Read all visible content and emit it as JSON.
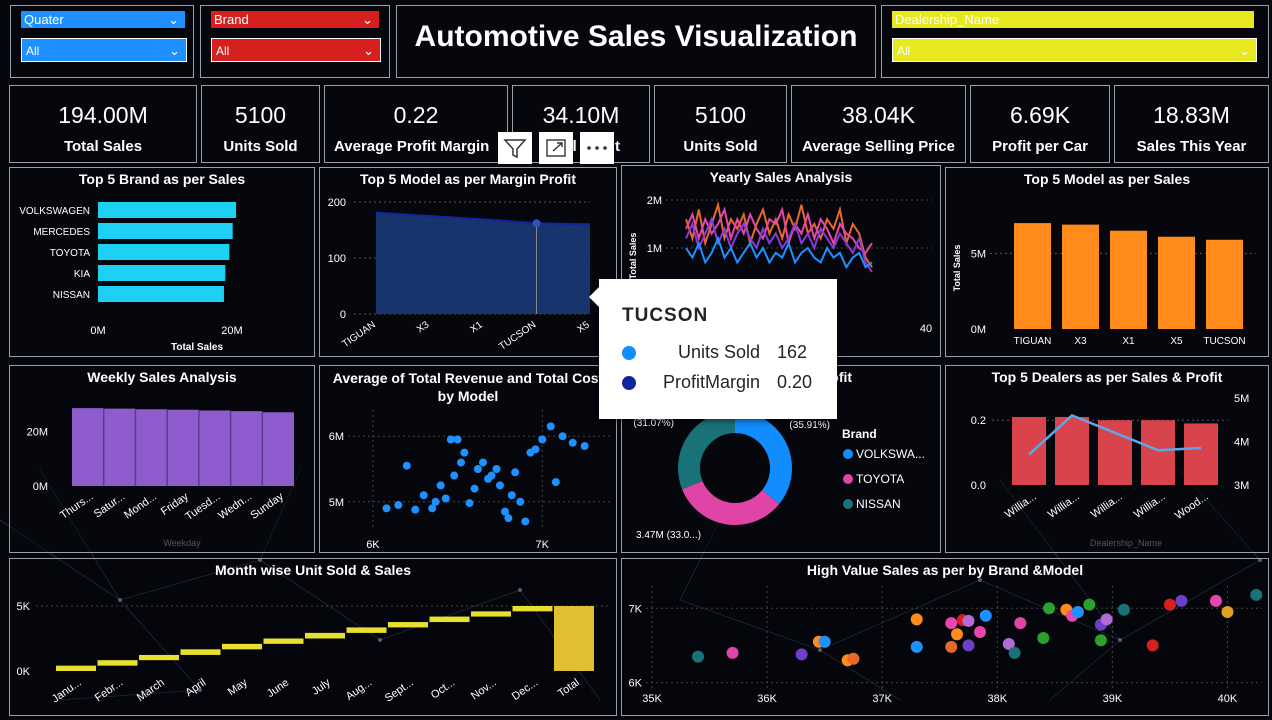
{
  "title": "Automotive Sales Visualization",
  "slicers": [
    {
      "label": "Quater",
      "value": "All",
      "color": "#1e90ff"
    },
    {
      "label": "Brand",
      "value": "All",
      "color": "#d62020"
    },
    {
      "label": "Dealership_Name",
      "value": "All",
      "color": "#e8e81e"
    }
  ],
  "kpis": [
    {
      "value": "194.00M",
      "label": "Total Sales"
    },
    {
      "value": "5100",
      "label": "Units Sold"
    },
    {
      "value": "0.22",
      "label": "Average Profit Margin"
    },
    {
      "value": "34.10M",
      "label": "Total Profit"
    },
    {
      "value": "5100",
      "label": "Units Sold"
    },
    {
      "value": "38.04K",
      "label": "Average Selling Price"
    },
    {
      "value": "6.69K",
      "label": "Profit per Car"
    },
    {
      "value": "18.83M",
      "label": "Sales This Year"
    }
  ],
  "visual_header_icons": [
    "filter-icon",
    "focus-mode-icon",
    "more-options-icon"
  ],
  "tooltip": {
    "title": "TUCSON",
    "rows": [
      {
        "name": "Units Sold",
        "value": "162",
        "color": "#118dff"
      },
      {
        "name": "ProfitMargin",
        "value": "0.20",
        "color": "#12239e"
      }
    ]
  },
  "chart_data": [
    {
      "id": "top5brand",
      "type": "bar",
      "orientation": "horizontal",
      "title": "Top 5 Brand as per Sales",
      "categories": [
        "VOLKSWAGEN",
        "MERCEDES",
        "TOYOTA",
        "KIA",
        "NISSAN"
      ],
      "values": [
        20.6,
        20.1,
        19.6,
        19.0,
        18.8
      ],
      "xlabel": "Total Sales",
      "xticks": [
        "0M",
        "20M"
      ],
      "xlim": [
        0,
        20
      ],
      "color": "#1fd0f5"
    },
    {
      "id": "top5margin",
      "type": "area",
      "title": "Top 5 Model as per Margin Profit",
      "categories": [
        "TIGUAN",
        "X3",
        "X1",
        "TUCSON",
        "X5"
      ],
      "values": [
        181,
        175,
        169,
        162,
        160
      ],
      "yticks": [
        "200",
        "100",
        "0"
      ],
      "ylim": [
        0,
        200
      ],
      "color": "#12239e"
    },
    {
      "id": "yearly",
      "type": "line",
      "title": "Yearly Sales Analysis",
      "ylabel": "Total Sales",
      "yticks": [
        "2M",
        "1M"
      ],
      "xticks": [
        "40"
      ],
      "series": [
        {
          "color": "#e8682c",
          "values": [
            1.6,
            1.2,
            1.8,
            1.1,
            1.5,
            1.9,
            1.2,
            1.6,
            1.4,
            1.7,
            1.1,
            1.5,
            1.8,
            1.3,
            1.6,
            1.2,
            1.7,
            1.4,
            1.9,
            1.3,
            1.5,
            1.2,
            1.6,
            1.4,
            1.8,
            1.1,
            1.5,
            1.3,
            0.8,
            0.6
          ]
        },
        {
          "color": "#e845ad",
          "values": [
            1.4,
            1.7,
            1.2,
            1.6,
            1.3,
            1.5,
            1.8,
            1.2,
            1.6,
            1.3,
            1.7,
            1.4,
            1.2,
            1.6,
            1.5,
            1.8,
            1.1,
            1.5,
            1.3,
            1.7,
            1.2,
            1.6,
            1.4,
            1.1,
            1.5,
            1.3,
            1.2,
            1.0,
            0.9,
            1.1
          ]
        },
        {
          "color": "#8a3bd6",
          "values": [
            1.2,
            1.5,
            1.0,
            1.3,
            1.6,
            1.1,
            1.4,
            1.0,
            1.3,
            1.5,
            1.2,
            1.0,
            1.4,
            1.1,
            1.3,
            1.0,
            1.2,
            1.5,
            1.1,
            1.3,
            1.0,
            1.4,
            1.2,
            1.0,
            1.3,
            1.1,
            0.9,
            1.2,
            0.7,
            0.5
          ]
        },
        {
          "color": "#1e90ff",
          "values": [
            1.0,
            0.8,
            1.1,
            0.7,
            0.9,
            1.2,
            0.8,
            1.0,
            0.7,
            0.9,
            1.1,
            0.8,
            1.0,
            0.7,
            0.9,
            0.8,
            1.1,
            0.7,
            0.9,
            1.0,
            0.8,
            0.7,
            1.0,
            0.8,
            0.9,
            0.6,
            0.8,
            0.9,
            0.6,
            0.7
          ]
        }
      ]
    },
    {
      "id": "top5model",
      "type": "bar",
      "title": "Top 5 Model as per Sales",
      "categories": [
        "TIGUAN",
        "X3",
        "X1",
        "X5",
        "TUCSON"
      ],
      "values": [
        7.0,
        6.9,
        6.5,
        6.1,
        5.9
      ],
      "ylabel": "Total Sales",
      "yticks": [
        "5M",
        "0M"
      ],
      "ylim": [
        0,
        8
      ],
      "color": "#ff8c1a"
    },
    {
      "id": "weekly",
      "type": "area",
      "title": "Weekly Sales Analysis",
      "categories": [
        "Thurs...",
        "Satur...",
        "Mond...",
        "Friday",
        "Tuesd...",
        "Wedn...",
        "Sunday"
      ],
      "values": [
        28.5,
        28.3,
        28.1,
        27.9,
        27.6,
        27.4,
        27.0
      ],
      "xlabel": "Weekday",
      "yticks": [
        "20M",
        "0M"
      ],
      "color": "#8e5ccc"
    },
    {
      "id": "revcost",
      "type": "scatter",
      "title": "Average of Total Revenue and Total Cost by Model",
      "xticks": [
        "6K",
        "7K"
      ],
      "yticks": [
        "6M",
        "5M"
      ],
      "xlim": [
        5.9,
        7.4
      ],
      "ylim": [
        4.6,
        6.4
      ],
      "color": "#1e90ff",
      "points": [
        [
          6.08,
          4.9
        ],
        [
          6.15,
          4.95
        ],
        [
          6.2,
          5.55
        ],
        [
          6.25,
          4.88
        ],
        [
          6.3,
          5.1
        ],
        [
          6.35,
          4.9
        ],
        [
          6.37,
          5.0
        ],
        [
          6.4,
          5.25
        ],
        [
          6.43,
          5.05
        ],
        [
          6.46,
          5.95
        ],
        [
          6.48,
          5.4
        ],
        [
          6.5,
          5.95
        ],
        [
          6.52,
          5.6
        ],
        [
          6.54,
          5.75
        ],
        [
          6.57,
          4.98
        ],
        [
          6.6,
          5.2
        ],
        [
          6.62,
          5.5
        ],
        [
          6.65,
          5.6
        ],
        [
          6.68,
          5.35
        ],
        [
          6.7,
          5.4
        ],
        [
          6.73,
          5.5
        ],
        [
          6.75,
          5.25
        ],
        [
          6.78,
          4.85
        ],
        [
          6.8,
          4.75
        ],
        [
          6.82,
          5.1
        ],
        [
          6.84,
          5.45
        ],
        [
          6.87,
          5.0
        ],
        [
          6.9,
          4.7
        ],
        [
          6.93,
          5.75
        ],
        [
          6.96,
          5.8
        ],
        [
          7.0,
          5.95
        ],
        [
          7.05,
          6.15
        ],
        [
          7.08,
          5.3
        ],
        [
          7.12,
          6.0
        ],
        [
          7.18,
          5.9
        ],
        [
          7.25,
          5.85
        ]
      ]
    },
    {
      "id": "donut",
      "type": "pie",
      "style": "donut",
      "title": "Total Sales and Profit",
      "legend_title": "Brand",
      "slices": [
        {
          "label": "VOLKSWA...",
          "value": 35.91,
          "color": "#118dff"
        },
        {
          "label": "TOYOTA",
          "value": 33.02,
          "color": "#e044a7"
        },
        {
          "label": "NISSAN",
          "value": 31.07,
          "color": "#197278"
        }
      ],
      "data_labels": [
        "(31.07%)",
        "(35.91%)",
        "3.47M (33.0...)"
      ]
    },
    {
      "id": "dealers",
      "type": "bar+line",
      "title": "Top 5 Dealers as per Sales & Profit",
      "categories": [
        "Willia...",
        "Willia...",
        "Willia...",
        "Willia...",
        "Wood..."
      ],
      "bar_values": [
        0.21,
        0.21,
        0.2,
        0.2,
        0.19
      ],
      "line_values": [
        3.7,
        4.6,
        4.2,
        3.8,
        3.85
      ],
      "yticks_left": [
        "0.2",
        "0.0"
      ],
      "yticks_right": [
        "5M",
        "4M",
        "3M"
      ],
      "xlabel": "Dealership_Name",
      "bar_color": "#d9434c",
      "line_color": "#5aa9e6"
    },
    {
      "id": "monthly",
      "type": "waterfall",
      "title": "Month wise Unit Sold & Sales",
      "categories": [
        "Janu...",
        "Febr...",
        "March",
        "April",
        "May",
        "June",
        "July",
        "Aug...",
        "Sept...",
        "Oct...",
        "Nov...",
        "Dec...",
        "Total"
      ],
      "values": [
        420,
        430,
        410,
        440,
        430,
        420,
        440,
        430,
        420,
        430,
        410,
        420,
        5100
      ],
      "yticks": [
        "5K",
        "0K"
      ],
      "color": "#e8e030",
      "total_color": "#e0c030"
    },
    {
      "id": "highvalue",
      "type": "scatter",
      "title": "High Value Sales as per by Brand &Model",
      "xticks": [
        "35K",
        "36K",
        "37K",
        "38K",
        "39K",
        "40K"
      ],
      "yticks": [
        "7K",
        "6K"
      ],
      "xlim": [
        35,
        40.3
      ],
      "ylim": [
        5.9,
        7.3
      ],
      "points": [
        {
          "x": 35.4,
          "y": 6.35,
          "c": "#197278"
        },
        {
          "x": 35.7,
          "y": 6.4,
          "c": "#e044a7"
        },
        {
          "x": 36.3,
          "y": 6.38,
          "c": "#6b3fc8"
        },
        {
          "x": 36.45,
          "y": 6.55,
          "c": "#ff8c1a"
        },
        {
          "x": 36.5,
          "y": 6.55,
          "c": "#1e90ff"
        },
        {
          "x": 36.7,
          "y": 6.3,
          "c": "#ff8c1a"
        },
        {
          "x": 36.75,
          "y": 6.32,
          "c": "#e8682c"
        },
        {
          "x": 37.3,
          "y": 6.85,
          "c": "#ff8c1a"
        },
        {
          "x": 37.3,
          "y": 6.48,
          "c": "#1e90ff"
        },
        {
          "x": 37.6,
          "y": 6.8,
          "c": "#e845ad"
        },
        {
          "x": 37.6,
          "y": 6.48,
          "c": "#e8682c"
        },
        {
          "x": 37.65,
          "y": 6.65,
          "c": "#ff8c1a"
        },
        {
          "x": 37.7,
          "y": 6.84,
          "c": "#d62020"
        },
        {
          "x": 37.75,
          "y": 6.83,
          "c": "#b26bd6"
        },
        {
          "x": 37.75,
          "y": 6.5,
          "c": "#6b3fc8"
        },
        {
          "x": 37.85,
          "y": 6.68,
          "c": "#e845ad"
        },
        {
          "x": 37.9,
          "y": 6.9,
          "c": "#1e90ff"
        },
        {
          "x": 38.1,
          "y": 6.52,
          "c": "#b26bd6"
        },
        {
          "x": 38.15,
          "y": 6.4,
          "c": "#197278"
        },
        {
          "x": 38.2,
          "y": 6.8,
          "c": "#e044a7"
        },
        {
          "x": 38.4,
          "y": 6.6,
          "c": "#2ca02c"
        },
        {
          "x": 38.45,
          "y": 7.0,
          "c": "#2ca02c"
        },
        {
          "x": 38.6,
          "y": 6.98,
          "c": "#ff8c1a"
        },
        {
          "x": 38.65,
          "y": 6.9,
          "c": "#e845ad"
        },
        {
          "x": 38.7,
          "y": 6.95,
          "c": "#1e90ff"
        },
        {
          "x": 38.8,
          "y": 7.05,
          "c": "#2ca02c"
        },
        {
          "x": 38.9,
          "y": 6.78,
          "c": "#6b3fc8"
        },
        {
          "x": 38.9,
          "y": 6.57,
          "c": "#2ca02c"
        },
        {
          "x": 38.95,
          "y": 6.85,
          "c": "#b26bd6"
        },
        {
          "x": 39.1,
          "y": 6.98,
          "c": "#197278"
        },
        {
          "x": 39.35,
          "y": 6.5,
          "c": "#d62020"
        },
        {
          "x": 39.5,
          "y": 7.05,
          "c": "#d62020"
        },
        {
          "x": 39.6,
          "y": 7.1,
          "c": "#6b3fc8"
        },
        {
          "x": 39.9,
          "y": 7.1,
          "c": "#e845ad"
        },
        {
          "x": 40.0,
          "y": 6.95,
          "c": "#e0a020"
        },
        {
          "x": 40.25,
          "y": 7.18,
          "c": "#197278"
        }
      ]
    }
  ]
}
